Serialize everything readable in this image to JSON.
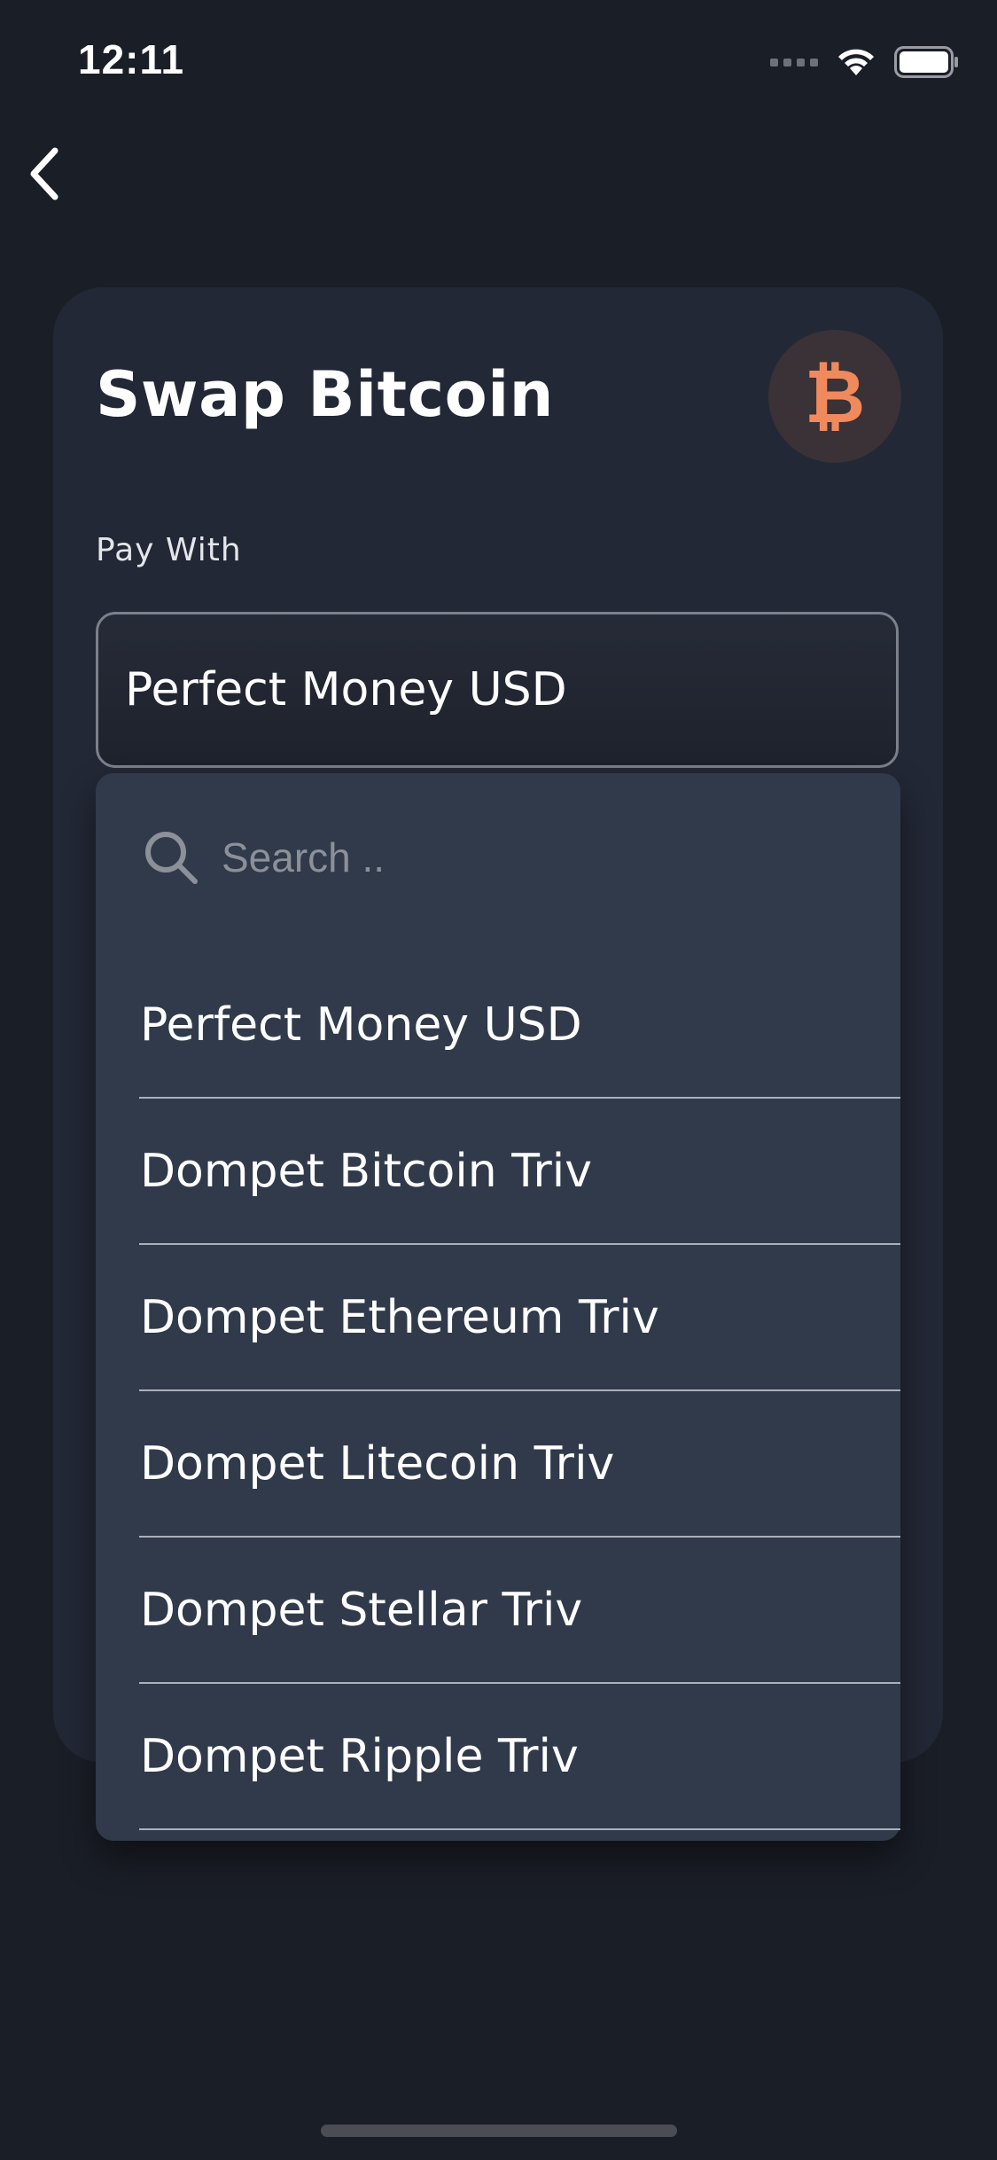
{
  "status_bar": {
    "time": "12:11"
  },
  "nav": {
    "back_icon": "chevron-left-icon"
  },
  "card": {
    "title": "Swap Bitcoin",
    "coin_icon": "bitcoin-icon",
    "coin_glyph": "₿",
    "coin_color": "#f08a5d",
    "pay_with_label": "Pay With",
    "selected_value": "Perfect Money USD"
  },
  "dropdown": {
    "search_placeholder": "Search ..",
    "options": [
      {
        "label": "Perfect Money USD"
      },
      {
        "label": "Dompet Bitcoin Triv"
      },
      {
        "label": "Dompet Ethereum Triv"
      },
      {
        "label": "Dompet Litecoin Triv"
      },
      {
        "label": "Dompet Stellar Triv"
      },
      {
        "label": "Dompet Ripple Triv"
      }
    ]
  },
  "colors": {
    "background": "#1a1e27",
    "card": "#232836",
    "dropdown": "#313a4b",
    "accent": "#f08a5d"
  }
}
